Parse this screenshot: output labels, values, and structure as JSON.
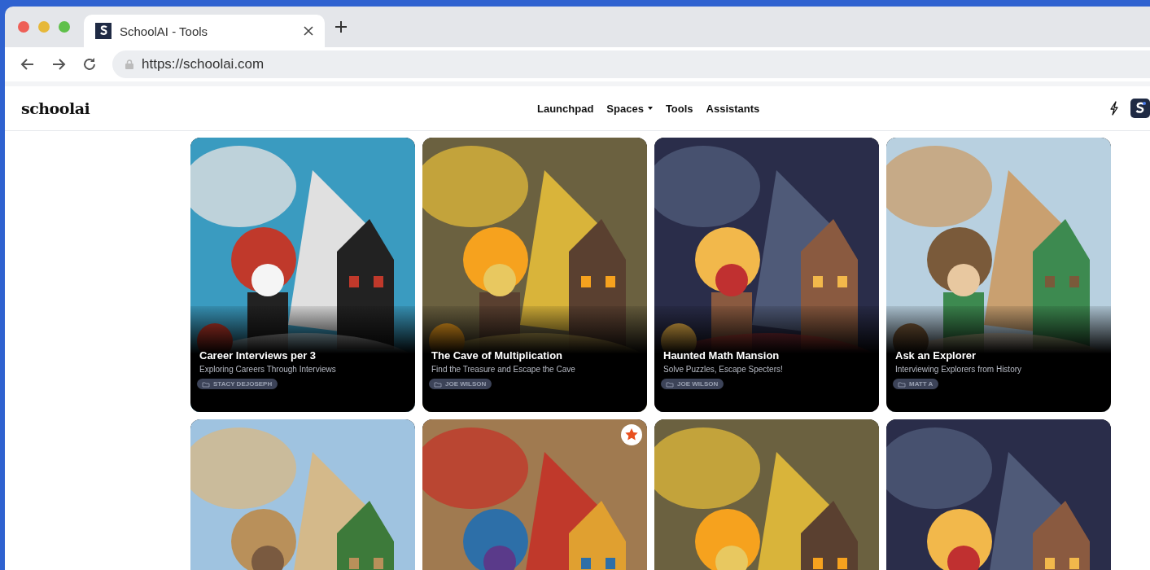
{
  "browser": {
    "tab_title": "SchoolAI - Tools",
    "url": "https://schoolai.com"
  },
  "header": {
    "logo": "schoolai",
    "nav": [
      {
        "label": "Launchpad",
        "dropdown": false
      },
      {
        "label": "Spaces",
        "dropdown": true
      },
      {
        "label": "Tools",
        "dropdown": false
      },
      {
        "label": "Assistants",
        "dropdown": false
      }
    ]
  },
  "cards": [
    {
      "title": "Career Interviews per 3",
      "subtitle": "Exploring Careers Through Interviews",
      "author": "STACY DEJOSEPH",
      "featured": false
    },
    {
      "title": "The Cave of Multiplication",
      "subtitle": "Find the Treasure and Escape the Cave",
      "author": "JOE WILSON",
      "featured": false
    },
    {
      "title": "Haunted Math Mansion",
      "subtitle": "Solve Puzzles, Escape Specters!",
      "author": "JOE WILSON",
      "featured": false
    },
    {
      "title": "Ask an Explorer",
      "subtitle": "Interviewing Explorers from History",
      "author": "MATT A",
      "featured": false
    },
    {
      "featured": false
    },
    {
      "featured": true
    },
    {
      "featured": false
    },
    {
      "featured": false
    }
  ]
}
